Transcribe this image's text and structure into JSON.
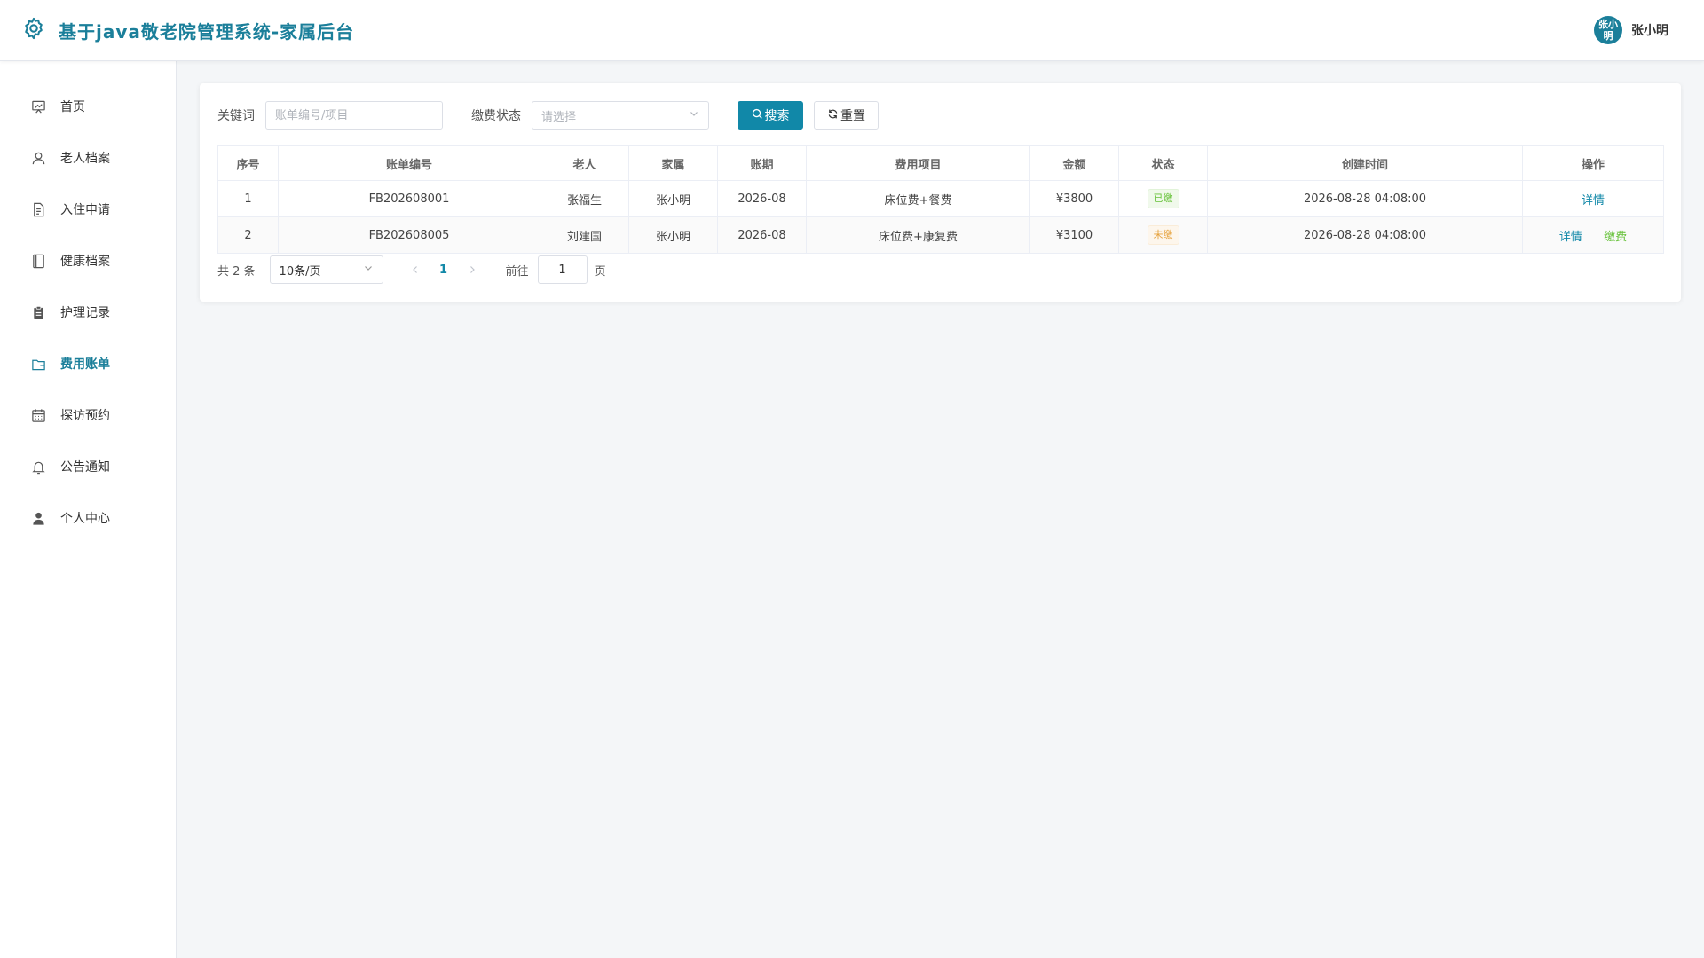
{
  "header": {
    "title": "基于java敬老院管理系统-家属后台",
    "user_avatar_text": "张小明",
    "user_name": "张小明",
    "brand_color": "#1b7f9a"
  },
  "sidebar": {
    "items": [
      {
        "label": "首页",
        "icon": "chart-board-icon"
      },
      {
        "label": "老人档案",
        "icon": "user-icon"
      },
      {
        "label": "入住申请",
        "icon": "document-icon"
      },
      {
        "label": "健康档案",
        "icon": "notebook-icon"
      },
      {
        "label": "护理记录",
        "icon": "clipboard-icon"
      },
      {
        "label": "费用账单",
        "icon": "wallet-icon",
        "active": true
      },
      {
        "label": "探访预约",
        "icon": "calendar-icon"
      },
      {
        "label": "公告通知",
        "icon": "bell-icon"
      },
      {
        "label": "个人中心",
        "icon": "user-filled-icon"
      }
    ]
  },
  "filters": {
    "keyword_label": "关键词",
    "keyword_placeholder": "账单编号/项目",
    "status_label": "缴费状态",
    "status_placeholder": "请选择",
    "search_label": "搜索",
    "reset_label": "重置"
  },
  "table": {
    "columns": [
      "序号",
      "账单编号",
      "老人",
      "家属",
      "账期",
      "费用项目",
      "金额",
      "状态",
      "创建时间",
      "操作"
    ],
    "rows": [
      {
        "index": "1",
        "bill_no": "FB202608001",
        "elder": "张福生",
        "family": "张小明",
        "period": "2026-08",
        "items": "床位费+餐费",
        "amount": "¥3800",
        "status": "已缴",
        "created": "2026-08-28 04:08:00",
        "actions": [
          "详情"
        ]
      },
      {
        "index": "2",
        "bill_no": "FB202608005",
        "elder": "刘建国",
        "family": "张小明",
        "period": "2026-08",
        "items": "床位费+康复费",
        "amount": "¥3100",
        "status": "未缴",
        "created": "2026-08-28 04:08:00",
        "actions": [
          "详情",
          "缴费"
        ]
      }
    ]
  },
  "pagination": {
    "total_text": "共 2 条",
    "page_size": "10条/页",
    "current_page": "1",
    "goto_label": "前往",
    "goto_value": "1",
    "page_unit": "页"
  }
}
